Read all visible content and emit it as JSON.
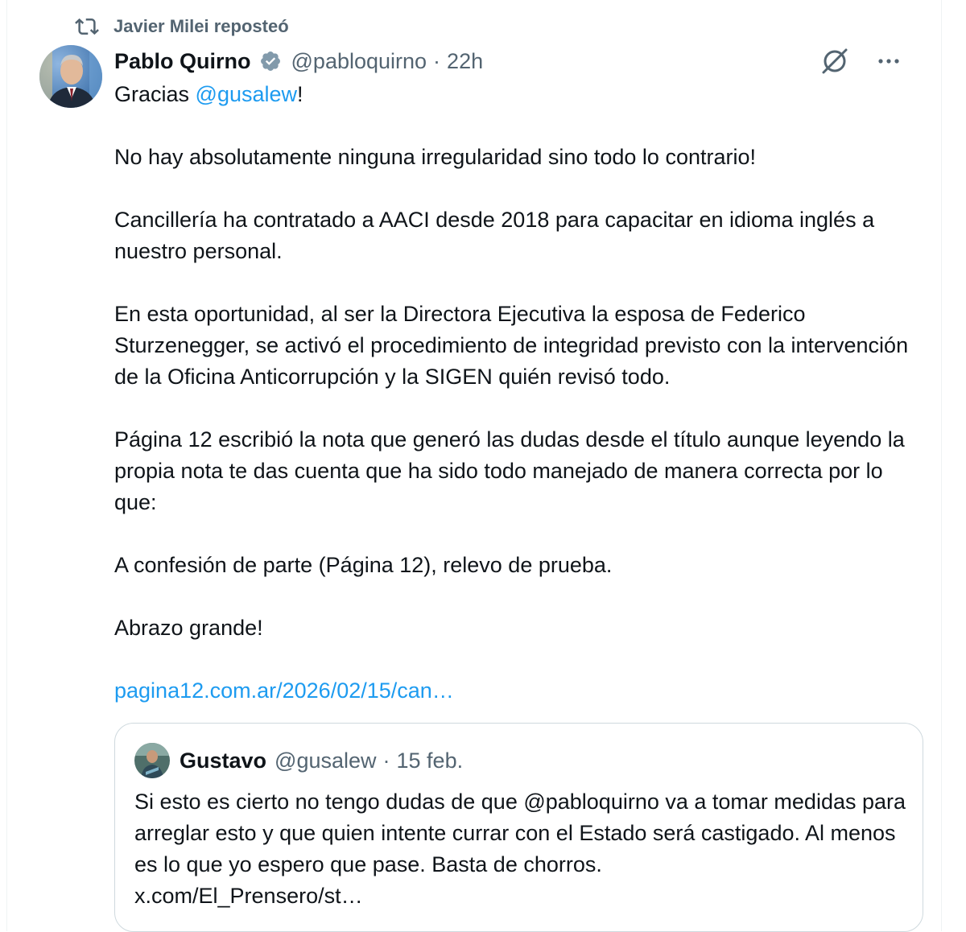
{
  "repost": {
    "label": "Javier Milei reposteó",
    "icon": "repost-icon"
  },
  "tweet": {
    "author_name": "Pablo Quirno",
    "handle": "@pabloquirno",
    "separator": "·",
    "time": "22h",
    "verified": true,
    "accent_color": "#1d9bf0",
    "text_color": "#0f1419",
    "muted_color": "#536471",
    "line1_prefix": "Gracias ",
    "line1_mention": "@gusalew",
    "line1_suffix": "!",
    "para2": "No hay absolutamente ninguna irregularidad sino todo lo contrario!",
    "para3": "Cancillería ha contratado a AACI desde 2018 para capacitar en idioma inglés a nuestro personal.",
    "para4": "En esta oportunidad, al ser la Directora Ejecutiva la esposa de Federico Sturzenegger, se activó el procedimiento de integridad previsto con la intervención de la Oficina Anticorrupción y la SIGEN quién revisó todo.",
    "para5": "Página 12 escribió la nota que generó las dudas desde el título aunque leyendo la propia nota te das cuenta que ha sido todo manejado de manera correcta por lo que:",
    "para6": "A confesión de parte (Página 12), relevo de prueba.",
    "para7": "Abrazo grande!",
    "link": "pagina12.com.ar/2026/02/15/can…"
  },
  "quote": {
    "author_name": "Gustavo",
    "handle": "@gusalew",
    "separator": "·",
    "date": "15 feb.",
    "text": "Si esto es cierto no tengo dudas de que @pabloquirno va a tomar medidas para arreglar esto y que quien intente currar con el Estado será castigado. Al menos es lo que yo espero que pase. Basta de chorros.",
    "link": "x.com/El_Prensero/st…"
  },
  "icons": {
    "grok": "grok-icon",
    "more": "more-icon",
    "verified": "verified-badge-icon"
  }
}
